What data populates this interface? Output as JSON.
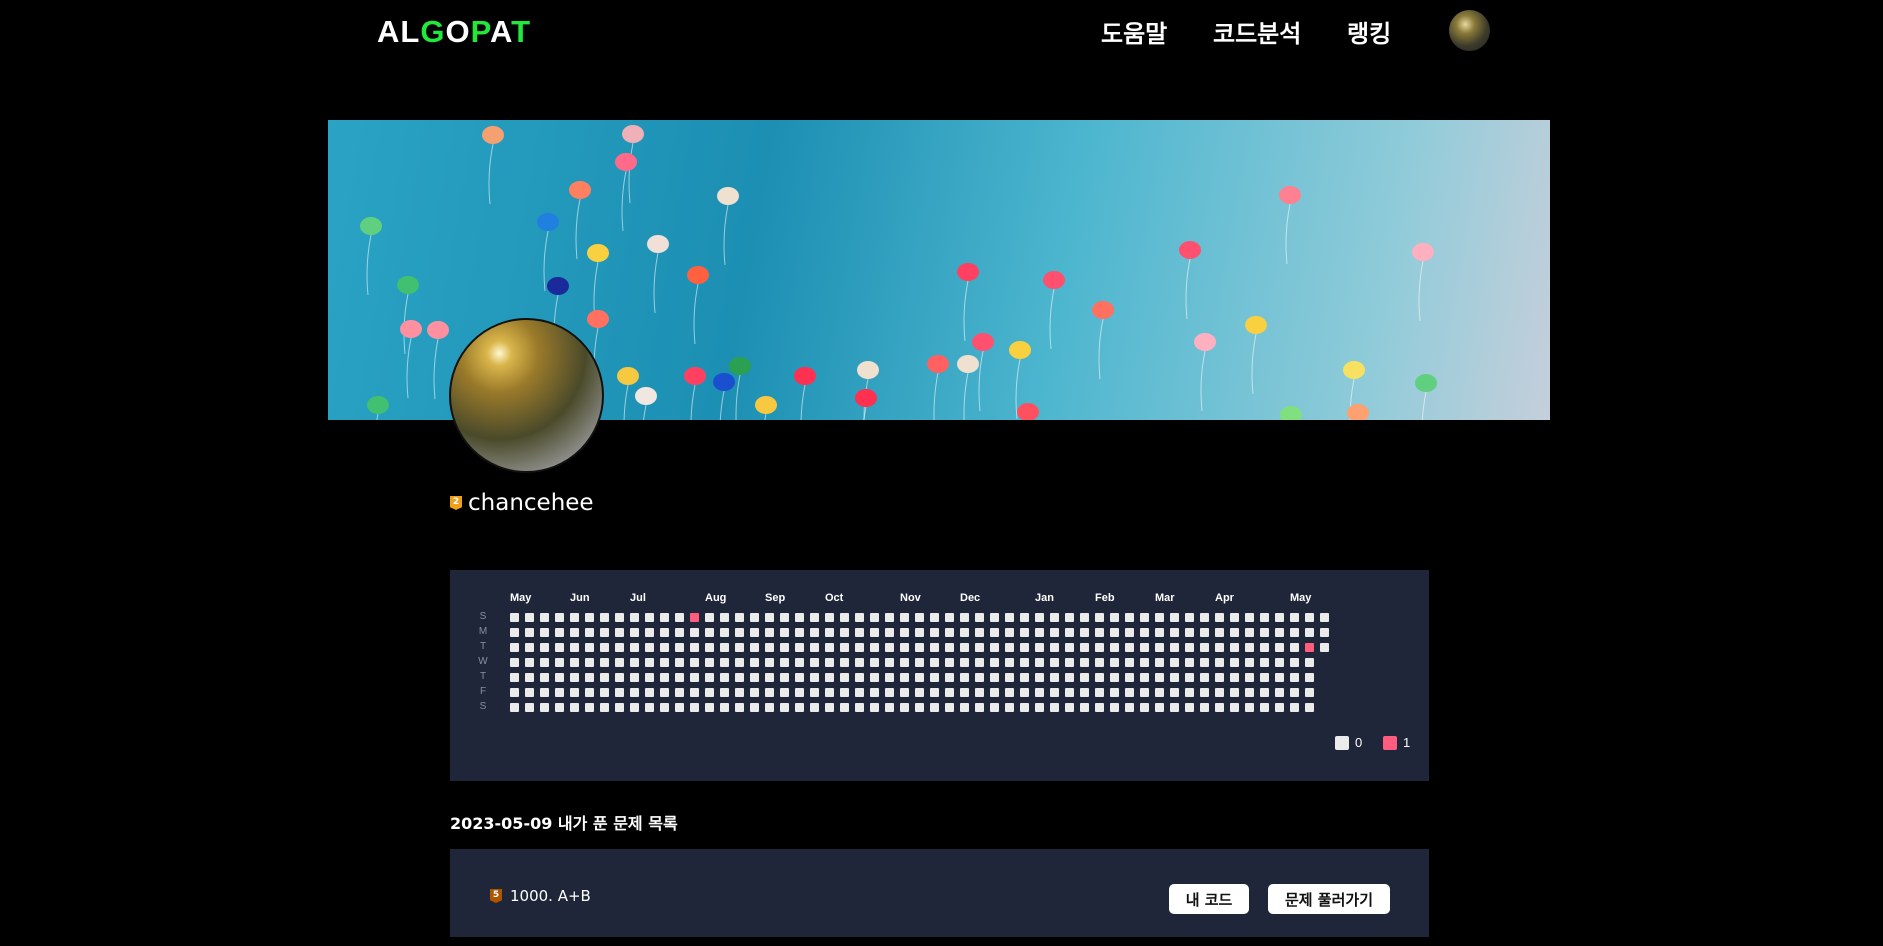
{
  "header": {
    "logo": [
      "AL",
      "G",
      "O",
      "P",
      "A",
      "T"
    ],
    "nav": [
      "도움말",
      "코드분석",
      "랭킹"
    ]
  },
  "profile": {
    "username": "chancehee",
    "tier_badge": "2"
  },
  "calendar": {
    "day_labels": [
      "S",
      "M",
      "T",
      "W",
      "T",
      "F",
      "S"
    ],
    "months": [
      {
        "label": "May",
        "week": 0
      },
      {
        "label": "Jun",
        "week": 4
      },
      {
        "label": "Jul",
        "week": 8
      },
      {
        "label": "Aug",
        "week": 13
      },
      {
        "label": "Sep",
        "week": 17
      },
      {
        "label": "Oct",
        "week": 21
      },
      {
        "label": "Nov",
        "week": 26
      },
      {
        "label": "Dec",
        "week": 30
      },
      {
        "label": "Jan",
        "week": 35
      },
      {
        "label": "Feb",
        "week": 39
      },
      {
        "label": "Mar",
        "week": 43
      },
      {
        "label": "Apr",
        "week": 47
      },
      {
        "label": "May",
        "week": 52
      }
    ],
    "weeks": 55,
    "last_week_days": 3,
    "active": [
      {
        "week": 12,
        "day": 0,
        "count": 1
      },
      {
        "week": 53,
        "day": 2,
        "count": 1
      }
    ],
    "legend": [
      {
        "label": "0",
        "color": "#ebebeb"
      },
      {
        "label": "1",
        "color": "#ff5c7e"
      }
    ]
  },
  "solved": {
    "heading": "2023-05-09 내가 푼 문제 목록",
    "items": [
      {
        "tier_badge": "5",
        "title": "1000.  A+B",
        "my_code": "내 코드",
        "solve": "문제 풀러가기"
      }
    ]
  }
}
